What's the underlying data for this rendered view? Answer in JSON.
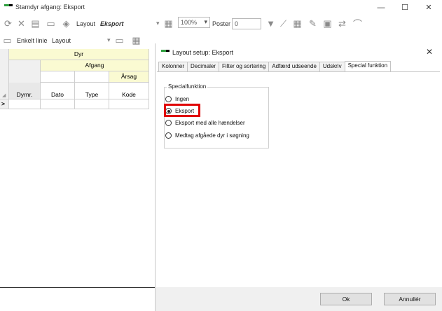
{
  "window": {
    "title": "Stamdyr afgang: Eksport",
    "minimize": "—",
    "maximize": "☐",
    "close": "✕"
  },
  "toolbar": {
    "layout_label": "Layout",
    "layout_value": "Eksport",
    "zoom": "100%",
    "poster_label": "Poster",
    "poster_value": "0"
  },
  "toolbar2": {
    "enkelt_linie_label": "Enkelt linie",
    "layout_placeholder": "Layout"
  },
  "grid": {
    "group_header": "Dyr",
    "subgroup_header": "Afgang",
    "subsub_header": "Årsag",
    "columns": [
      "Dyrnr.",
      "Dato",
      "Type",
      "Kode"
    ],
    "row_marker": ">"
  },
  "dialog": {
    "title": "Layout setup: Eksport",
    "close": "✕",
    "tabs": [
      "Kolonner",
      "Decimaler",
      "Filter og sortering",
      "Adfærd  udseende",
      "Udskriv",
      "Special funktion"
    ],
    "active_tab": "Special funktion",
    "group_title": "Specialfunktion",
    "options": [
      {
        "label": "Ingen",
        "checked": false
      },
      {
        "label": "Eksport",
        "checked": true
      },
      {
        "label": "Eksport med alle hændelser",
        "checked": false
      },
      {
        "label": "Medtag afgåede dyr i søgning",
        "checked": false
      }
    ],
    "ok_button": "Ok",
    "cancel_button": "Annullér"
  },
  "colors": {
    "grid_header_bg": "#fafad2",
    "highlight": "#e00000",
    "brand_green": "#2e9e3e"
  }
}
